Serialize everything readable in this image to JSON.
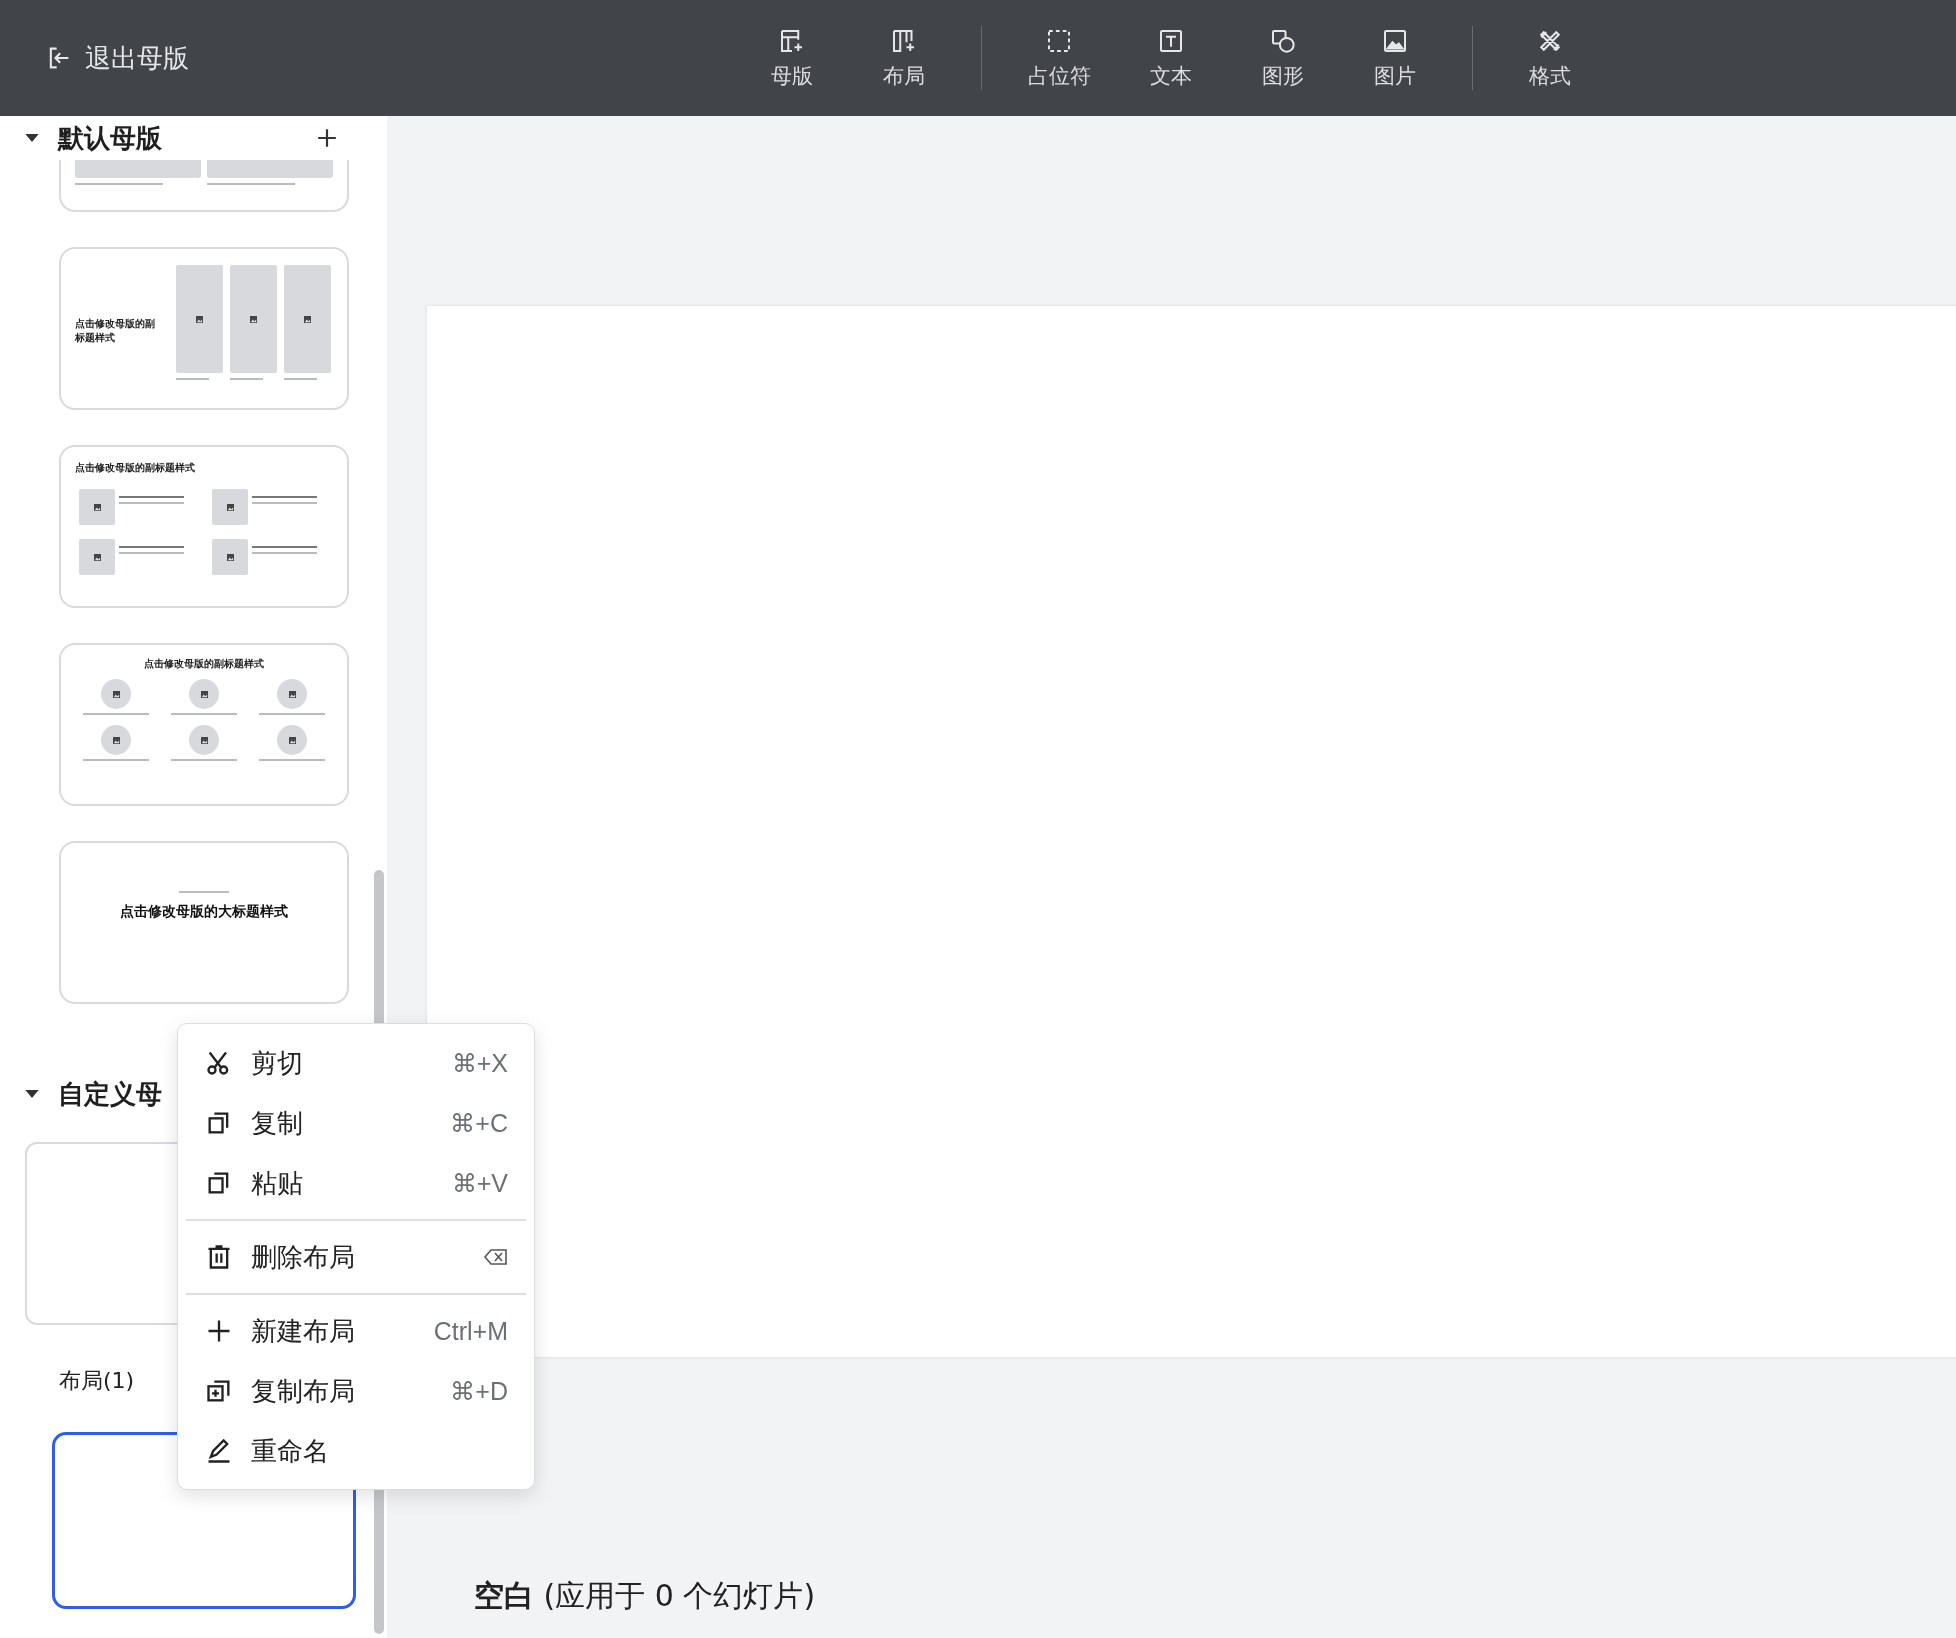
{
  "topbar": {
    "exit_label": "退出母版",
    "tool_groups": [
      [
        {
          "label": "母版"
        },
        {
          "label": "布局"
        }
      ],
      [
        {
          "label": "占位符"
        },
        {
          "label": "文本"
        },
        {
          "label": "图形"
        },
        {
          "label": "图片"
        }
      ],
      [
        {
          "label": "格式"
        }
      ]
    ]
  },
  "sidebar": {
    "sections": [
      {
        "title": "默认母版",
        "expanded": true,
        "thumbnails": [
          {
            "kind": "two-images-partial"
          },
          {
            "kind": "three-images",
            "subtitle": "点击修改母版的副标题样式"
          },
          {
            "kind": "four-items",
            "subtitle": "点击修改母版的副标题样式"
          },
          {
            "kind": "six-circles",
            "subtitle": "点击修改母版的副标题样式"
          },
          {
            "kind": "title",
            "title": "点击修改母版的大标题样式"
          }
        ]
      },
      {
        "title": "自定义母",
        "expanded": true,
        "thumbnails": [
          {
            "kind": "blank"
          }
        ],
        "layouts_label": "布局(1)",
        "layouts": [
          {
            "selected": true
          }
        ]
      }
    ]
  },
  "canvas": {
    "caption": "**空白** (应用于 0 个幻灯片)"
  },
  "context_menu": {
    "groups": [
      [
        {
          "label": "剪切",
          "shortcut": "⌘+X"
        },
        {
          "label": "复制",
          "shortcut": "⌘+C"
        },
        {
          "label": "粘贴",
          "shortcut": "⌘+V"
        }
      ],
      [
        {
          "label": "删除布局"
        }
      ],
      [
        {
          "label": "新建布局",
          "shortcut": "Ctrl+M"
        },
        {
          "label": "复制布局",
          "shortcut": "⌘+D"
        },
        {
          "label": "重命名"
        }
      ]
    ]
  }
}
